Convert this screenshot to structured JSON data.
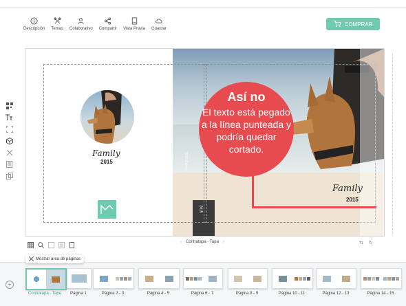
{
  "toolbar": {
    "items": [
      {
        "label": "Descripción",
        "icon": "info-icon"
      },
      {
        "label": "Temas",
        "icon": "themes-icon"
      },
      {
        "label": "Colaborativo",
        "icon": "collaborate-icon"
      },
      {
        "label": "Compartir",
        "icon": "share-icon"
      },
      {
        "label": "Vista Previa",
        "icon": "preview-icon"
      },
      {
        "label": "Guardar",
        "icon": "cloud-save-icon"
      }
    ],
    "buy_label": "COMPRAR"
  },
  "canvas": {
    "left_family": "Family",
    "left_year": "2015",
    "right_family": "Family",
    "right_year": "2015",
    "spine_year": "2015",
    "spine_text": "2015 Family"
  },
  "tip": {
    "title": "Así no",
    "body": "El texto está pegado a la línea punteada y podría quedar cortado."
  },
  "pagenav": {
    "current": "Contratapa - Tapa"
  },
  "show_area_label": "Mostrar área de páginas",
  "pages": [
    {
      "label": "Contratapa - Tapa",
      "selected": true
    },
    {
      "label": "Página 1",
      "selected": false
    },
    {
      "label": "Página 2 - 3",
      "selected": false
    },
    {
      "label": "Página 4 - 5",
      "selected": false
    },
    {
      "label": "Página 6 - 7",
      "selected": false
    },
    {
      "label": "Página 8 - 9",
      "selected": false
    },
    {
      "label": "Página 10 - 11",
      "selected": false
    },
    {
      "label": "Página 12 - 13",
      "selected": false
    },
    {
      "label": "Página 14 - 15",
      "selected": false
    }
  ],
  "colors": {
    "accent": "#6fcbb0",
    "alert": "#e84b4f"
  }
}
